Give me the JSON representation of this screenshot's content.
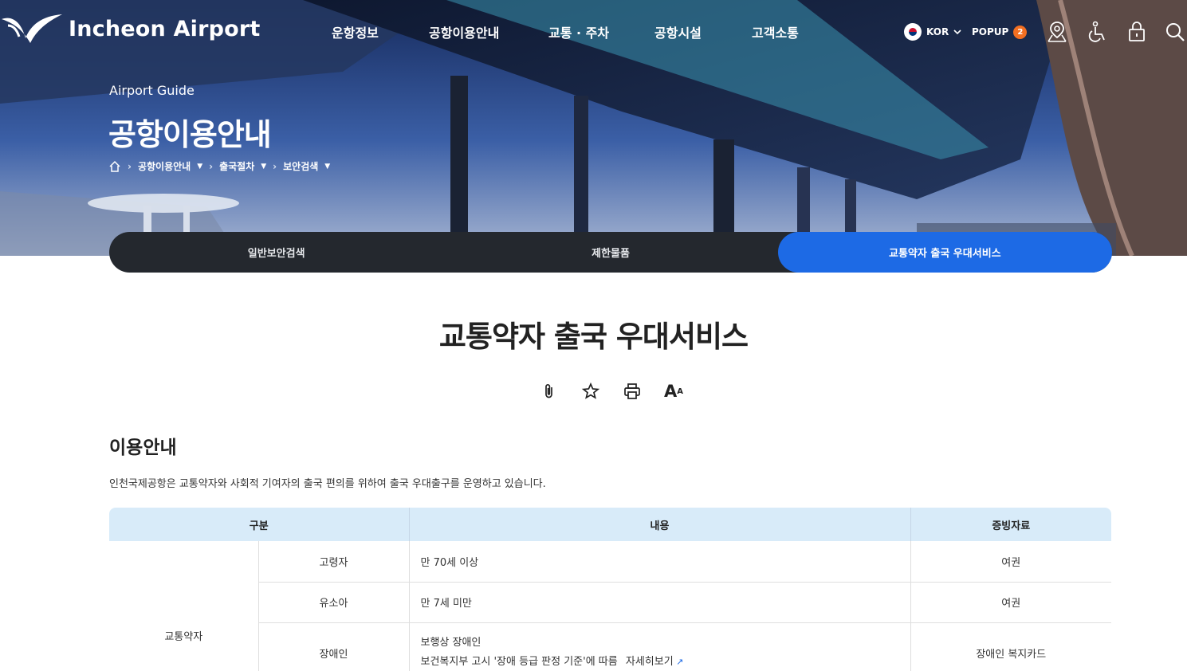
{
  "header": {
    "logo_text": "Incheon Airport",
    "nav": [
      {
        "label": "운항정보"
      },
      {
        "label": "공항이용안내"
      },
      {
        "label": "교통 · 주차"
      },
      {
        "label": "공항시설"
      },
      {
        "label": "고객소통"
      }
    ],
    "lang_label": "KOR",
    "popup_label": "POPUP",
    "popup_count": "2",
    "icons": [
      "map-pin-icon",
      "wheelchair-icon",
      "lock-icon",
      "search-icon"
    ]
  },
  "hero": {
    "guide_label": "Airport Guide",
    "title": "공항이용안내",
    "breadcrumb": [
      "공항이용안내",
      "출국절차",
      "보안검색"
    ]
  },
  "tabs": [
    {
      "label": "일반보안검색",
      "active": false
    },
    {
      "label": "제한물품",
      "active": false
    },
    {
      "label": "교통약자 출국 우대서비스",
      "active": true
    }
  ],
  "content": {
    "title": "교통약자 출국 우대서비스",
    "tools": [
      "paperclip-icon",
      "star-icon",
      "print-icon",
      "font-size-icon"
    ],
    "font_tool_big": "A",
    "font_tool_small": "A",
    "section_title": "이용안내",
    "section_desc": "인천국제공항은 교통약자와 사회적 기여자의 출국 편의를 위하여 출국 우대출구를 운영하고 있습니다.",
    "table": {
      "headers": [
        "구분",
        "내용",
        "증빙자료"
      ],
      "group_label": "교통약자",
      "rows": [
        {
          "type": "고령자",
          "content": "만 70세 이상",
          "proof": "여권"
        },
        {
          "type": "유소아",
          "content": "만 7세 미만",
          "proof": "여권"
        },
        {
          "type": "장애인",
          "content": "보행상 장애인",
          "content2": "보건복지부 고시 '장애 등급 판정 기준'에 따름",
          "link": "자세히보기",
          "proof": "장애인 복지카드"
        }
      ]
    }
  },
  "colors": {
    "accent": "#1d6ae5",
    "tab_bg": "#24282e",
    "table_head": "#d8ebf9",
    "badge": "#f36f21"
  }
}
